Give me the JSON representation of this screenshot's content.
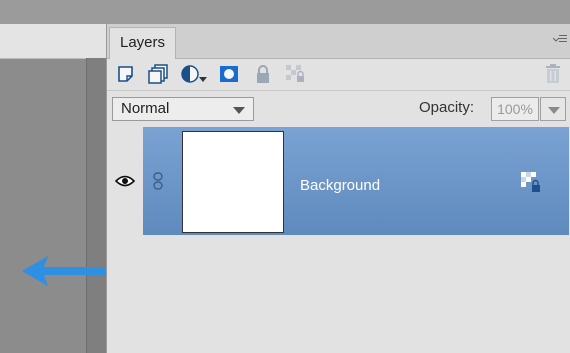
{
  "panel": {
    "tab_label": "Layers",
    "menu_icon": "panel-menu-icon"
  },
  "toolbar": {
    "tools": [
      {
        "name": "new-layer-icon"
      },
      {
        "name": "new-group-icon"
      },
      {
        "name": "adjustment-layer-icon"
      },
      {
        "name": "layer-mask-icon"
      },
      {
        "name": "lock-all-icon"
      },
      {
        "name": "lock-transparent-icon"
      },
      {
        "name": "trash-icon"
      }
    ]
  },
  "blend": {
    "mode": "Normal",
    "opacity_label": "Opacity:",
    "opacity_value": "100%"
  },
  "layers": [
    {
      "name": "Background",
      "visible": true,
      "selected": true,
      "locked": true
    }
  ],
  "colors": {
    "selection": "#6b95c6",
    "arrow": "#2f8fe3"
  }
}
